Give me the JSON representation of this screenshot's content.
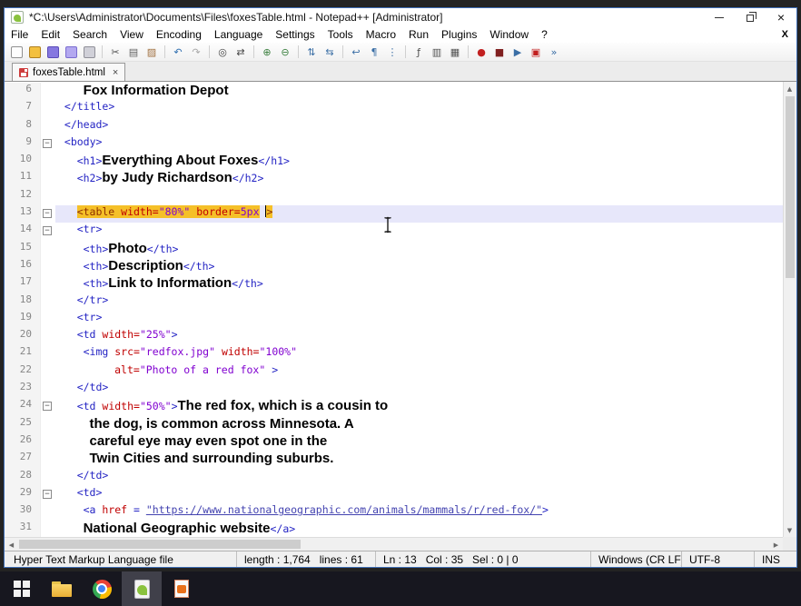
{
  "colors": {
    "tag": "#2424c4",
    "attribute": "#c00000",
    "value": "#8000d0",
    "text": "#000000",
    "link": "#4343b0",
    "tag_match_bg": "#f5c028",
    "current_line_bg": "#e7e7fa"
  },
  "window": {
    "title": "*C:\\Users\\Administrator\\Documents\\Files\\foxesTable.html - Notepad++ [Administrator]",
    "close_glyph": "×"
  },
  "menu": {
    "items": [
      "File",
      "Edit",
      "Search",
      "View",
      "Encoding",
      "Language",
      "Settings",
      "Tools",
      "Macro",
      "Run",
      "Plugins",
      "Window",
      "?"
    ],
    "close_label": "X"
  },
  "toolbar": {
    "groups": [
      [
        {
          "name": "new-file-icon",
          "glyph": "",
          "bg": "#fdfdfd",
          "border": "#909090"
        },
        {
          "name": "open-folder-icon",
          "glyph": "",
          "bg": "#f3c03f",
          "border": "#b08020"
        },
        {
          "name": "save-icon",
          "glyph": "",
          "bg": "#8678e0",
          "border": "#5a4cb8"
        },
        {
          "name": "save-all-icon",
          "glyph": "",
          "bg": "#b3a8f0",
          "border": "#7a6cd0"
        },
        {
          "name": "print-icon",
          "glyph": "",
          "bg": "#d0d0d8",
          "border": "#909098"
        }
      ],
      [
        {
          "name": "cut-icon",
          "glyph": "✂",
          "fg": "#505050"
        },
        {
          "name": "copy-icon",
          "glyph": "▤",
          "fg": "#606060"
        },
        {
          "name": "paste-icon",
          "glyph": "▨",
          "fg": "#a07040"
        }
      ],
      [
        {
          "name": "undo-icon",
          "glyph": "↶",
          "fg": "#2f6fb0"
        },
        {
          "name": "redo-icon",
          "glyph": "↷",
          "fg": "#a8a8a8"
        }
      ],
      [
        {
          "name": "find-icon",
          "glyph": "◎",
          "fg": "#404040"
        },
        {
          "name": "replace-icon",
          "glyph": "⇄",
          "fg": "#404040"
        }
      ],
      [
        {
          "name": "zoom-in-icon",
          "glyph": "⊕",
          "fg": "#3c8040"
        },
        {
          "name": "zoom-out-icon",
          "glyph": "⊖",
          "fg": "#3c8040"
        }
      ],
      [
        {
          "name": "sync-vertical-scroll-icon",
          "glyph": "⇅",
          "fg": "#3a6ea5"
        },
        {
          "name": "sync-horizontal-scroll-icon",
          "glyph": "⇆",
          "fg": "#3a6ea5"
        }
      ],
      [
        {
          "name": "word-wrap-icon",
          "glyph": "↩",
          "fg": "#3a6ea5"
        },
        {
          "name": "show-all-characters-icon",
          "glyph": "¶",
          "fg": "#3a6ea5"
        },
        {
          "name": "indent-guide-icon",
          "glyph": "⋮",
          "fg": "#3a6ea5"
        }
      ],
      [
        {
          "name": "function-list-icon",
          "glyph": "ƒ",
          "fg": "#505050"
        },
        {
          "name": "document-map-icon",
          "glyph": "▥",
          "fg": "#505050"
        },
        {
          "name": "folder-workspace-icon",
          "glyph": "▦",
          "fg": "#505050"
        }
      ],
      [
        {
          "name": "record-macro-icon",
          "glyph": "●",
          "fg": "#c22020"
        },
        {
          "name": "stop-macro-icon",
          "glyph": "■",
          "fg": "#802020"
        },
        {
          "name": "play-macro-icon",
          "glyph": "▶",
          "fg": "#3a6ea5"
        },
        {
          "name": "save-macro-icon",
          "glyph": "▣",
          "fg": "#c22020"
        },
        {
          "name": "run-macro-multiple-icon",
          "glyph": "»",
          "fg": "#3a6ea5"
        }
      ]
    ]
  },
  "tabbar": {
    "close_glyph": "×",
    "tabs": [
      {
        "label": "foxesTable.html",
        "modified": true
      }
    ]
  },
  "editor": {
    "fold_glyph": "−",
    "scroll_icons": {
      "up": "▲",
      "down": "▼",
      "left": "◀",
      "right": "▶"
    },
    "lines": [
      {
        "num": 6,
        "indent": 4,
        "tokens": [
          {
            "t": "text",
            "s": "Fox Information Depot"
          }
        ]
      },
      {
        "num": 7,
        "indent": 1,
        "tokens": [
          {
            "t": "tag",
            "s": "</title>"
          }
        ]
      },
      {
        "num": 8,
        "indent": 1,
        "tokens": [
          {
            "t": "tag",
            "s": "</head>"
          }
        ]
      },
      {
        "num": 9,
        "indent": 1,
        "fold": true,
        "tokens": [
          {
            "t": "tag",
            "s": "<body>"
          }
        ]
      },
      {
        "num": 10,
        "indent": 3,
        "tokens": [
          {
            "t": "tag",
            "s": "<h1>"
          },
          {
            "t": "text",
            "s": "Everything About Foxes"
          },
          {
            "t": "tag",
            "s": "</h1>"
          }
        ]
      },
      {
        "num": 11,
        "indent": 3,
        "tokens": [
          {
            "t": "tag",
            "s": "<h2>"
          },
          {
            "t": "text",
            "s": "by Judy Richardson"
          },
          {
            "t": "tag",
            "s": "</h2>"
          }
        ]
      },
      {
        "num": 12,
        "indent": 0,
        "tokens": []
      },
      {
        "num": 13,
        "indent": 3,
        "fold": true,
        "current": true,
        "tokens": [
          {
            "t": "tagm",
            "s": "<table",
            "hl": true
          },
          {
            "t": "attr",
            "s": " width=",
            "hl": true
          },
          {
            "t": "val",
            "s": "\"80%\"",
            "hl": true
          },
          {
            "t": "attr",
            "s": " border=",
            "hl": true
          },
          {
            "t": "val",
            "s": "5px",
            "hl": true
          },
          {
            "t": "plain",
            "s": " "
          },
          {
            "t": "caret"
          },
          {
            "t": "tagm",
            "s": ">",
            "hl": true
          }
        ]
      },
      {
        "num": 14,
        "indent": 3,
        "fold": true,
        "tokens": [
          {
            "t": "tag",
            "s": "<tr>"
          }
        ]
      },
      {
        "num": 15,
        "indent": 4,
        "tokens": [
          {
            "t": "tag",
            "s": "<th>"
          },
          {
            "t": "text",
            "s": "Photo"
          },
          {
            "t": "tag",
            "s": "</th>"
          }
        ]
      },
      {
        "num": 16,
        "indent": 4,
        "tokens": [
          {
            "t": "tag",
            "s": "<th>"
          },
          {
            "t": "text",
            "s": "Description"
          },
          {
            "t": "tag",
            "s": "</th>"
          }
        ]
      },
      {
        "num": 17,
        "indent": 4,
        "tokens": [
          {
            "t": "tag",
            "s": "<th>"
          },
          {
            "t": "text",
            "s": "Link to Information"
          },
          {
            "t": "tag",
            "s": "</th>"
          }
        ]
      },
      {
        "num": 18,
        "indent": 3,
        "tokens": [
          {
            "t": "tag",
            "s": "</tr>"
          }
        ]
      },
      {
        "num": 19,
        "indent": 3,
        "tokens": [
          {
            "t": "tag",
            "s": "<tr>"
          }
        ]
      },
      {
        "num": 20,
        "indent": 3,
        "tokens": [
          {
            "t": "tag",
            "s": "<td"
          },
          {
            "t": "attr",
            "s": " width="
          },
          {
            "t": "val",
            "s": "\"25%\""
          },
          {
            "t": "tag",
            "s": ">"
          }
        ]
      },
      {
        "num": 21,
        "indent": 4,
        "tokens": [
          {
            "t": "tag",
            "s": "<img"
          },
          {
            "t": "attr",
            "s": " src="
          },
          {
            "t": "val",
            "s": "\"redfox.jpg\""
          },
          {
            "t": "attr",
            "s": " width="
          },
          {
            "t": "val",
            "s": "\"100%\""
          }
        ]
      },
      {
        "num": 22,
        "indent": 9,
        "tokens": [
          {
            "t": "attr",
            "s": "alt="
          },
          {
            "t": "val",
            "s": "\"Photo of a red fox\""
          },
          {
            "t": "tag",
            "s": " >"
          }
        ]
      },
      {
        "num": 23,
        "indent": 3,
        "tokens": [
          {
            "t": "tag",
            "s": "</td>"
          }
        ]
      },
      {
        "num": 24,
        "indent": 3,
        "fold": true,
        "tokens": [
          {
            "t": "tag",
            "s": "<td"
          },
          {
            "t": "attr",
            "s": " width="
          },
          {
            "t": "val",
            "s": "\"50%\""
          },
          {
            "t": "tag",
            "s": ">"
          },
          {
            "t": "text",
            "s": "The red fox, which is a cousin to"
          }
        ]
      },
      {
        "num": 25,
        "indent": 5,
        "tokens": [
          {
            "t": "text",
            "s": "the dog, is common across Minnesota. A"
          }
        ]
      },
      {
        "num": 26,
        "indent": 5,
        "tokens": [
          {
            "t": "text",
            "s": "careful eye may even spot one in the"
          }
        ]
      },
      {
        "num": 27,
        "indent": 5,
        "tokens": [
          {
            "t": "text",
            "s": "Twin Cities and surrounding suburbs."
          }
        ]
      },
      {
        "num": 28,
        "indent": 3,
        "tokens": [
          {
            "t": "tag",
            "s": "</td>"
          }
        ]
      },
      {
        "num": 29,
        "indent": 3,
        "fold": true,
        "tokens": [
          {
            "t": "tag",
            "s": "<td>"
          }
        ]
      },
      {
        "num": 30,
        "indent": 4,
        "tokens": [
          {
            "t": "tag",
            "s": "<a"
          },
          {
            "t": "attr",
            "s": " href"
          },
          {
            "t": "tag",
            "s": " = "
          },
          {
            "t": "link",
            "s": "\"https://www.nationalgeographic.com/animals/mammals/r/red-fox/\""
          },
          {
            "t": "tag",
            "s": ">"
          }
        ]
      },
      {
        "num": 31,
        "indent": 4,
        "tokens": [
          {
            "t": "text",
            "s": "National Geographic website"
          },
          {
            "t": "tag",
            "s": "</a>"
          }
        ]
      }
    ]
  },
  "status": {
    "segments": [
      {
        "name": "doc-type",
        "text": "Hyper Text Markup Language file"
      },
      {
        "name": "length-lines",
        "text": "length : 1,764   lines : 61"
      },
      {
        "name": "cursor-position",
        "text": "Ln : 13   Col : 35   Sel : 0 | 0"
      },
      {
        "name": "eol-format",
        "text": "Windows (CR LF)"
      },
      {
        "name": "encoding",
        "text": "UTF-8"
      },
      {
        "name": "insert-mode",
        "text": "INS"
      }
    ]
  },
  "taskbar": {
    "apps": [
      {
        "name": "start-button",
        "icon": "windows-logo-icon",
        "type": "start"
      },
      {
        "name": "file-explorer-app",
        "icon": "folder-icon",
        "type": "explorer"
      },
      {
        "name": "chrome-app",
        "icon": "chrome-icon",
        "type": "chrome"
      },
      {
        "name": "notepadpp-app",
        "icon": "notepadpp-icon",
        "type": "npp",
        "active": true
      },
      {
        "name": "presentation-app",
        "icon": "orange-document-icon",
        "type": "odoc"
      }
    ]
  }
}
